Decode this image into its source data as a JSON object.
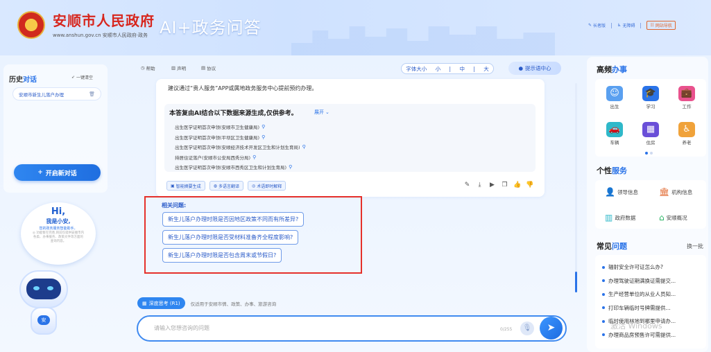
{
  "header": {
    "title": "安顺市人民政府",
    "url_text": "www.anshun.gov.cn  安顺市人民政府·政务",
    "ai_title": "AI+政务问答",
    "links": [
      "长者版",
      "无障碍",
      "网站导航"
    ]
  },
  "history": {
    "title_a": "历史",
    "title_b": "对话",
    "clear_label": "一键清空",
    "items": [
      {
        "label": "安顺市新生儿落户办理"
      }
    ],
    "new_button": "开启新对话"
  },
  "assistant": {
    "hi": "Hi,",
    "intro": "我是小安,",
    "sub": "您的政务服务智能助手。",
    "note": "◎ 功能暂在完善,目前仅提供安顺市内各类、办事服务、政策文件等方面的查询内容。",
    "badge": "安"
  },
  "toolbar": {
    "help": "帮助",
    "statement": "声明",
    "agreement": "协议",
    "font_label": "字体大小",
    "font_small": "小",
    "font_mid": "中",
    "font_large": "大",
    "hint_center": "提示语中心"
  },
  "answer": {
    "line1": "建议通过“贵人服务”APP或属地政务服务中心提前预约办理。",
    "source_title": "本答复由AI结合以下数据来源生成,仅供参考。",
    "expand": "展开",
    "sources": [
      "出生医学证明首次申领(安顺市卫生健康局)",
      "出生医学证明首次申领(平坝区卫生健康局)",
      "出生医学证明首次申领(安顺经济技术开发区卫生和计划生育局)",
      "持居住证落户(安顺市公安局西秀分局)",
      "出生医学证明首次申领(安顺市西秀区卫生和计划生育局)"
    ],
    "actions": [
      "智能摘要生成",
      "多语言翻译",
      "术语即时解释"
    ]
  },
  "related": {
    "title": "相关问题:",
    "questions": [
      "新生儿落户办理时限是否因地区政策不同而有所差异?",
      "新生儿落户办理时限是否受材料准备齐全程度影响?",
      "新生儿落户办理时限是否包含周末或节假日?"
    ]
  },
  "composer": {
    "deep_label": "深度思考 (R1)",
    "deep_note": "仅适用于安顺市情、政策、办事、旅游咨询",
    "placeholder": "请输入您想咨询的问题",
    "counter": "0/255"
  },
  "hot": {
    "title_a": "高频",
    "title_b": "办事",
    "items": [
      {
        "label": "出生",
        "color": "#5aa0f0"
      },
      {
        "label": "学习",
        "color": "#2a73e8"
      },
      {
        "label": "工作",
        "color": "#e9528d"
      },
      {
        "label": "车辆",
        "color": "#2fb8c9"
      },
      {
        "label": "住房",
        "color": "#6a4fd8"
      },
      {
        "label": "养老",
        "color": "#f0a23a"
      }
    ]
  },
  "personal": {
    "title_a": "个性",
    "title_b": "服务",
    "items": [
      "领导信息",
      "机构信息",
      "政府数据",
      "安顺概况"
    ]
  },
  "faq": {
    "title_a": "常见",
    "title_b": "问题",
    "swap": "换一批",
    "items": [
      "辐射安全许可证怎么办?",
      "办理驾驶证期满换证需提交...",
      "生产经营单位的从业人员知...",
      "打印车辆临时号牌需提供...",
      "临时使用林地到哪里申请办...",
      "办理商品房预售许可需提供..."
    ]
  },
  "watermark": "激活 Windows"
}
